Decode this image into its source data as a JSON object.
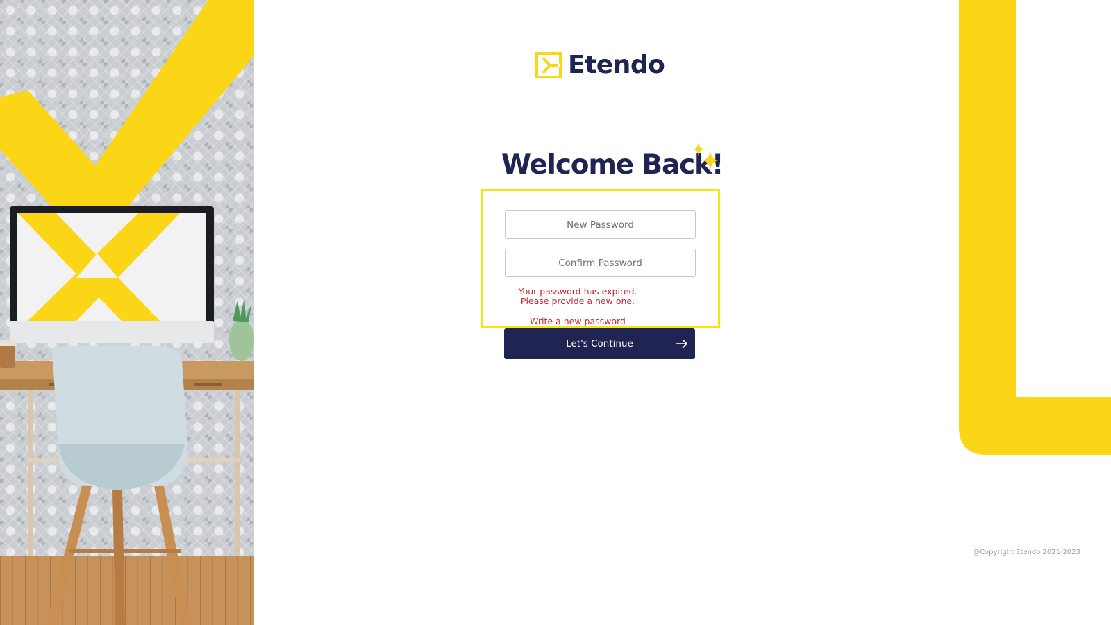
{
  "app": {
    "brand_name": "Etendo"
  },
  "colors": {
    "brand_navy": "#202452",
    "brand_yellow": "#fbd616",
    "error_red": "#d0242c",
    "highlight_yellow": "#f5e612"
  },
  "icons": {
    "logo": "etendo-e-logo-icon",
    "sparkle": "sparkle-icon",
    "continue": "arrow-right-icon"
  },
  "login": {
    "title": "Welcome Back!",
    "new_password": {
      "placeholder": "New Password",
      "value": ""
    },
    "confirm_password": {
      "placeholder": "Confirm Password",
      "value": ""
    },
    "error_lines": [
      "Your password has expired.",
      "Please provide a new one."
    ],
    "hint": "Write a new password",
    "continue_label": "Let's Continue"
  },
  "footer": {
    "copyright": "@Copyright Etendo 2021-2023"
  }
}
